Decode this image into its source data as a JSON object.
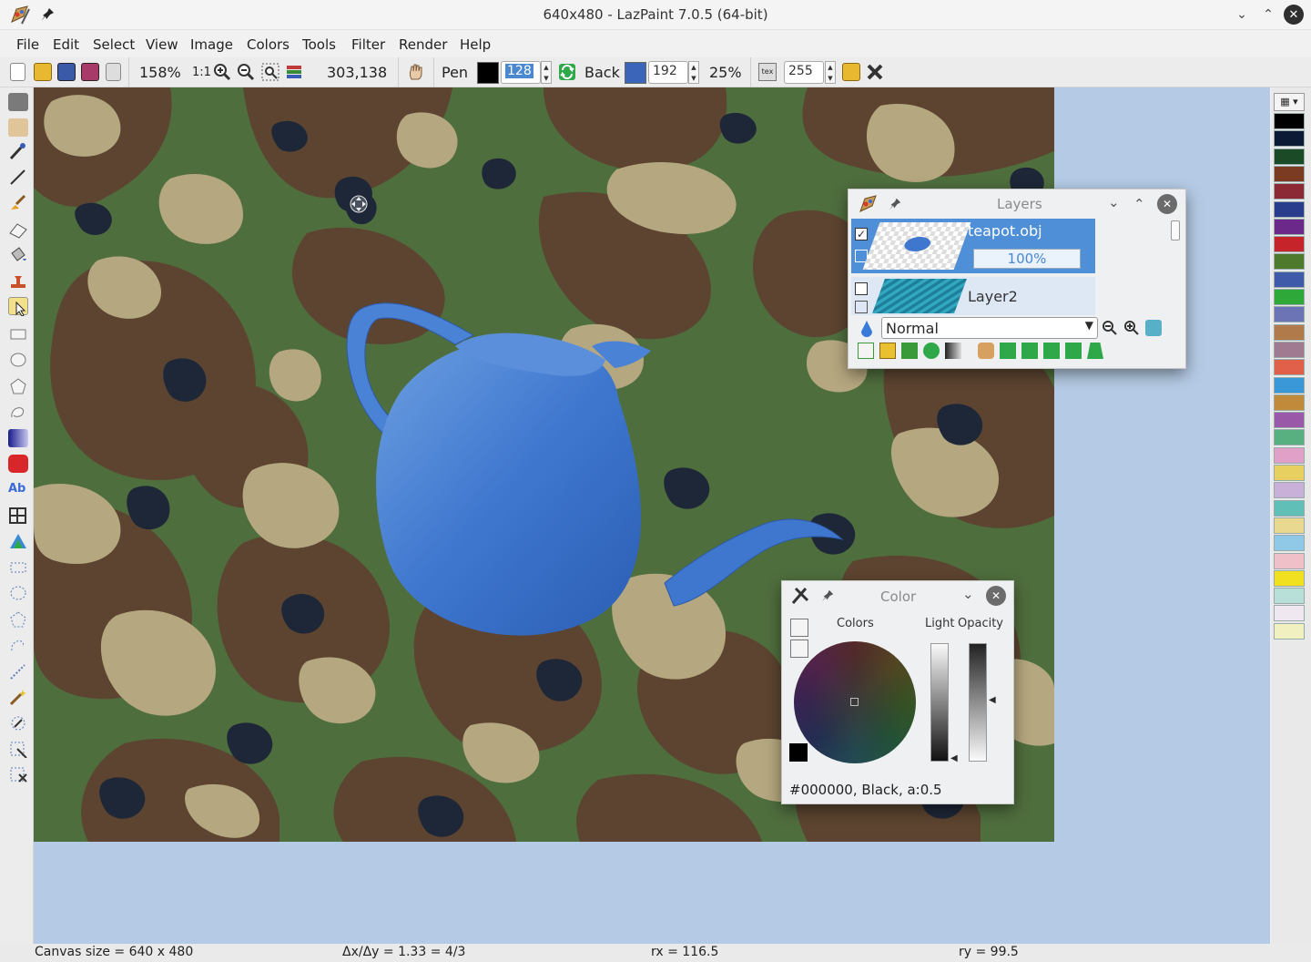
{
  "window": {
    "title": "640x480 - LazPaint 7.0.5 (64-bit)",
    "min_glyph": "⌄",
    "max_glyph": "⌃",
    "close_glyph": "✕"
  },
  "menu": [
    "File",
    "Edit",
    "Select",
    "View",
    "Image",
    "Colors",
    "Tools",
    "Filter",
    "Render",
    "Help"
  ],
  "toolbar": {
    "zoom": "158%",
    "zoom_1to1": "1:1",
    "coords": "303,138",
    "pen_label": "Pen",
    "pen_color": "#000000",
    "pen_alpha": "128",
    "back_label": "Back",
    "back_color": "#3a65b8",
    "back_alpha": "192",
    "tolerance": "25%",
    "tex_label": "tex",
    "tex_alpha": "255"
  },
  "layers_panel": {
    "title": "Layers",
    "layers": [
      {
        "name": "teapot.obj",
        "opacity": "100%",
        "visible": true,
        "selected": true
      },
      {
        "name": "Layer2",
        "visible": false,
        "selected": false
      }
    ],
    "blend_mode": "Normal"
  },
  "color_panel": {
    "title": "Color",
    "colors_label": "Colors",
    "light_label": "Light",
    "opacity_label": "Opacity",
    "current": "#000000, Black, a:0.5"
  },
  "palette": [
    "#000000",
    "#0d1a36",
    "#1a4a26",
    "#7a3b22",
    "#8b2a35",
    "#2a3c8c",
    "#6b2a8a",
    "#c4242a",
    "#4d7a2d",
    "#3f5aa8",
    "#2fa83a",
    "#6c74b6",
    "#b07a4a",
    "#a07a90",
    "#e0604a",
    "#3a98d8",
    "#c08a3a",
    "#9a58a8",
    "#58b080",
    "#e0a0c8",
    "#e8d060",
    "#c8b0d8",
    "#60c0b8",
    "#e8d890",
    "#90c8e8",
    "#f0c0c8",
    "#f0e020",
    "#b8e0d8",
    "#f0e8f0",
    "#f0f0c0"
  ],
  "status": {
    "canvas_size": "Canvas size = 640 x 480",
    "ratio": "Δx/Δy = 1.33 = 4/3",
    "rx": "rx = 116.5",
    "ry": "ry = 99.5"
  },
  "icons": {
    "app": "lazpaint-app-icon",
    "pin": "pin-icon",
    "zoom_in": "zoom-in-icon",
    "zoom_out": "zoom-out-icon",
    "hand": "hand-icon"
  }
}
